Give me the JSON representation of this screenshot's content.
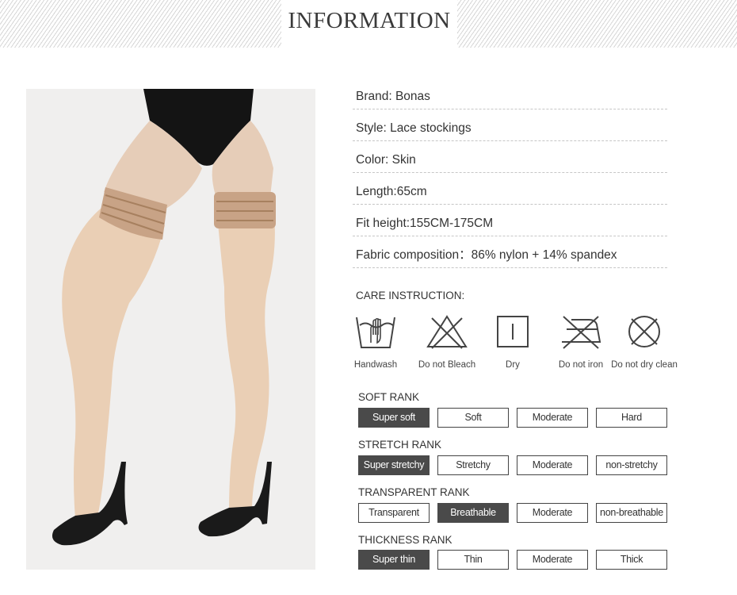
{
  "header": {
    "title": "INFORMATION"
  },
  "specs": [
    "Brand:  Bonas",
    "Style:  Lace stockings",
    "Color:  Skin",
    "Length:65cm",
    "Fit height:155CM-175CM",
    "Fabric composition：86% nylon + 14% spandex"
  ],
  "care": {
    "title": "CARE INSTRUCTION:",
    "items": [
      {
        "label": "Handwash",
        "icon": "handwash-icon"
      },
      {
        "label": "Do not Bleach",
        "icon": "no-bleach-icon"
      },
      {
        "label": "Dry",
        "icon": "dry-icon"
      },
      {
        "label": "Do not iron",
        "icon": "no-iron-icon"
      },
      {
        "label": "Do not dry clean",
        "icon": "no-dry-clean-icon"
      }
    ]
  },
  "ranks": [
    {
      "title": "SOFT RANK",
      "options": [
        "Super soft",
        "Soft",
        "Moderate",
        "Hard"
      ],
      "selected": 0
    },
    {
      "title": "STRETCH RANK",
      "options": [
        "Super stretchy",
        "Stretchy",
        "Moderate",
        "non-stretchy"
      ],
      "selected": 0
    },
    {
      "title": "TRANSPARENT RANK",
      "options": [
        "Transparent",
        "Breathable",
        "Moderate",
        "non-breathable"
      ],
      "selected": 1
    },
    {
      "title": "THICKNESS RANK",
      "options": [
        "Super thin",
        "Thin",
        "Moderate",
        "Thick"
      ],
      "selected": 0
    }
  ],
  "colors": {
    "selected_bg": "#4a4a4a",
    "stocking": "#e9cfb6",
    "lace": "#caa488"
  }
}
